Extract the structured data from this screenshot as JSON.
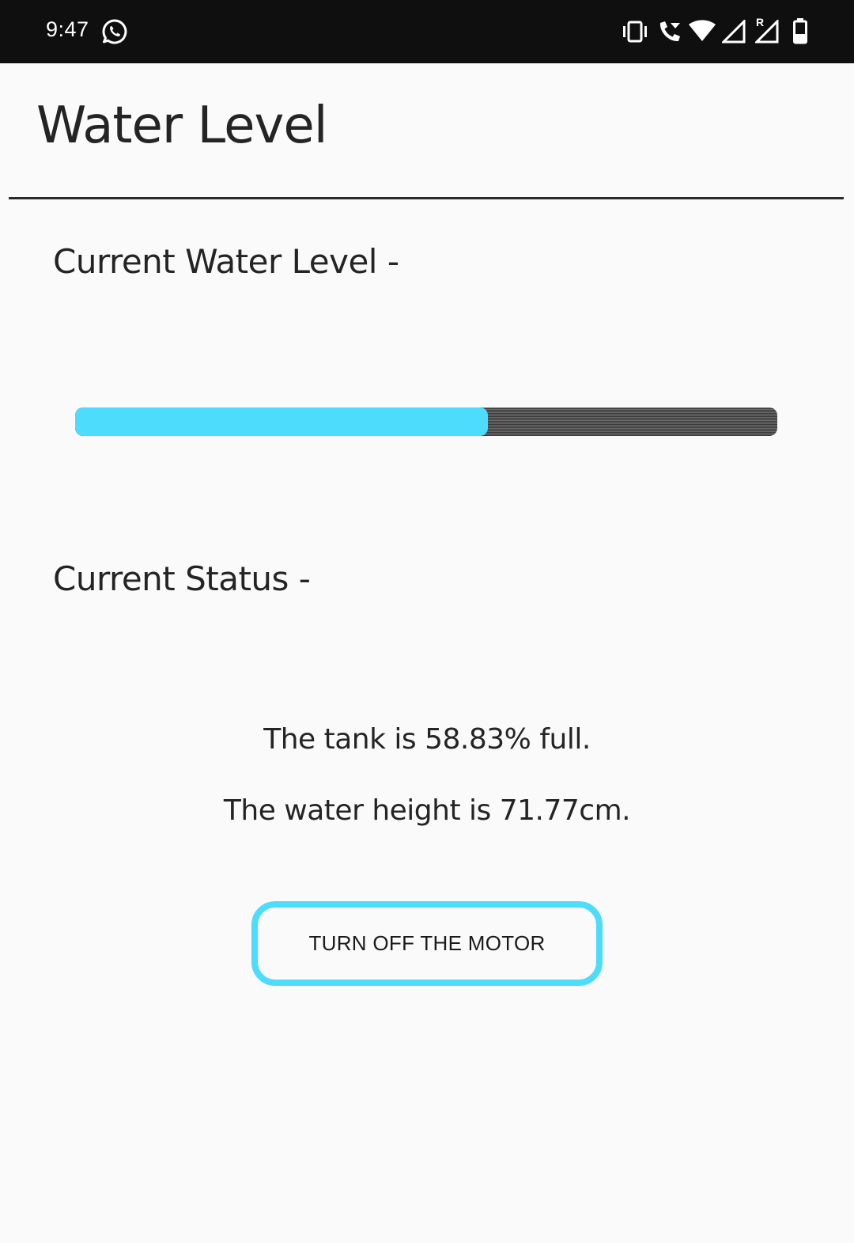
{
  "status_bar": {
    "time": "9:47",
    "icons": [
      "whatsapp-icon",
      "vibrate-icon",
      "wifi-calling-icon",
      "wifi-icon",
      "signal-icon",
      "signal-roaming-icon",
      "battery-icon"
    ],
    "roaming_indicator": "R"
  },
  "app_bar": {
    "title": "Water Level"
  },
  "level_section": {
    "label": "Current Water Level -",
    "progress_percent": 58.83,
    "fill_color": "#4ddcfb",
    "track_color": "#4a4a4a"
  },
  "status_section": {
    "label": "Current Status -",
    "tank_text": "The tank is 58.83% full.",
    "height_text": "The water height is 71.77cm."
  },
  "action": {
    "button_label": "TURN OFF THE MOTOR",
    "accent_color": "#4ddcfb"
  }
}
